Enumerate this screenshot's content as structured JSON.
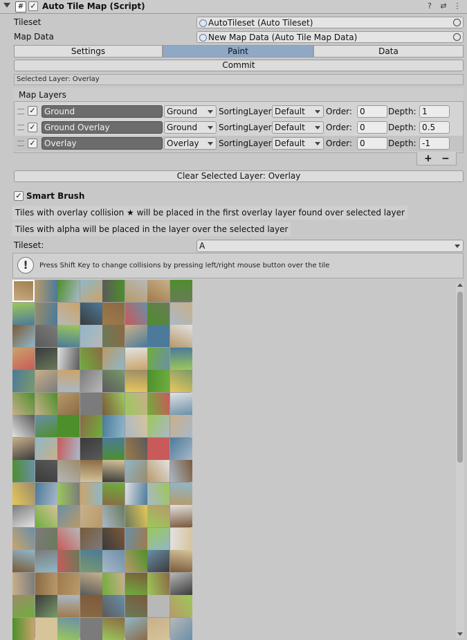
{
  "header": {
    "title": "Auto Tile Map (Script)",
    "enabled_check": "✓",
    "icons": [
      "help-icon",
      "presets-icon",
      "more-icon"
    ]
  },
  "fields": {
    "tileset_label": "Tileset",
    "tileset_value": "AutoTileset (Auto Tileset)",
    "mapdata_label": "Map Data",
    "mapdata_value": "New Map Data (Auto Tile Map Data)"
  },
  "tabs": [
    {
      "label": "Settings",
      "active": false
    },
    {
      "label": "Paint",
      "active": true
    },
    {
      "label": "Data",
      "active": false
    }
  ],
  "commit_label": "Commit",
  "selected_layer_text": "Selected Layer: Overlay",
  "map_layers": {
    "title": "Map Layers",
    "sorting_label": "SortingLayer:",
    "order_label": "Order:",
    "depth_label": "Depth:",
    "rows": [
      {
        "name": "Ground",
        "type": "Ground",
        "sorting": "Default",
        "order": "0",
        "depth": "1",
        "checked": "✓"
      },
      {
        "name": "Ground Overlay",
        "type": "Ground",
        "sorting": "Default",
        "order": "0",
        "depth": "0.5",
        "checked": "✓"
      },
      {
        "name": "Overlay",
        "type": "Overlay",
        "sorting": "Default",
        "order": "0",
        "depth": "-1",
        "checked": "✓"
      }
    ],
    "add_label": "+",
    "remove_label": "−"
  },
  "clear_label": "Clear Selected Layer: Overlay",
  "smart_brush": {
    "label": "Smart Brush",
    "checked": "✓",
    "info1": "Tiles with overlay collision ★ will be placed in the first overlay layer found over selected layer",
    "info2": "Tiles with alpha will be placed in the layer over the selected layer"
  },
  "tileset_select": {
    "label": "Tileset:",
    "value": "A"
  },
  "help_text": "Press Shift Key to change collisions by pressing left/right mouse button over the tile",
  "palette_colors": [
    "#6fae3c",
    "#4d8f2b",
    "#9cc85a",
    "#7b7b7b",
    "#9a8b6a",
    "#b79a6a",
    "#caa46a",
    "#8a6a44",
    "#6a8fa8",
    "#8fb7c8",
    "#4b7a9a",
    "#c8b08a",
    "#d6c49a",
    "#a07a4a",
    "#7a5a3a",
    "#5a5a5a",
    "#b8b8b8",
    "#e2e2e2",
    "#c85a5a",
    "#e8c85a",
    "#7a9a6a",
    "#aab8c8",
    "#6a7a5a",
    "#3a3a3a"
  ]
}
